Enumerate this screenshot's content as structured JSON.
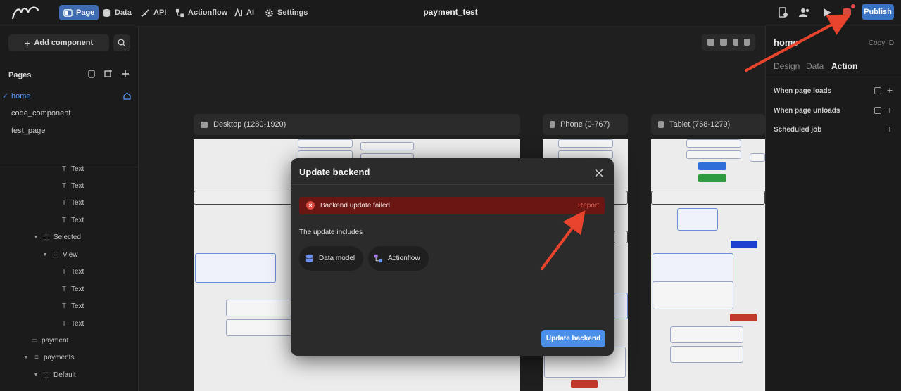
{
  "topbar": {
    "nav": [
      {
        "label": "Page",
        "icon": "page-icon",
        "active": true
      },
      {
        "label": "Data",
        "icon": "database-icon"
      },
      {
        "label": "API",
        "icon": "api-icon"
      },
      {
        "label": "Actionflow",
        "icon": "actionflow-icon"
      },
      {
        "label": "AI",
        "icon": "ai-icon"
      },
      {
        "label": "Settings",
        "icon": "gear-icon"
      }
    ],
    "title": "payment_test",
    "publish_label": "Publish"
  },
  "sidebar": {
    "add_component_label": "Add component",
    "pages_label": "Pages",
    "pages": [
      {
        "label": "home",
        "active": true
      },
      {
        "label": "code_component"
      },
      {
        "label": "test_page"
      }
    ],
    "tree": [
      {
        "label": "Text",
        "icon": "text-icon"
      },
      {
        "label": "Text",
        "icon": "text-icon"
      },
      {
        "label": "Text",
        "icon": "text-icon"
      },
      {
        "label": "Text",
        "icon": "text-icon"
      },
      {
        "label": "Selected",
        "icon": "view-icon"
      },
      {
        "label": "View",
        "icon": "view-icon"
      },
      {
        "label": "Text",
        "icon": "text-icon"
      },
      {
        "label": "Text",
        "icon": "text-icon"
      },
      {
        "label": "Text",
        "icon": "text-icon"
      },
      {
        "label": "Text",
        "icon": "text-icon"
      },
      {
        "label": "payment",
        "icon": "component-icon"
      },
      {
        "label": "payments",
        "icon": "list-icon"
      },
      {
        "label": "Default",
        "icon": "view-icon"
      }
    ]
  },
  "right_panel": {
    "title": "home",
    "copy_id_label": "Copy ID",
    "tabs": [
      {
        "label": "Design"
      },
      {
        "label": "Data"
      },
      {
        "label": "Action",
        "active": true
      }
    ],
    "rows": [
      {
        "label": "When page loads"
      },
      {
        "label": "When page unloads"
      },
      {
        "label": "Scheduled job"
      }
    ]
  },
  "canvas": {
    "frames": [
      {
        "label": "Desktop (1280-1920)"
      },
      {
        "label": "Phone (0-767)"
      },
      {
        "label": "Tablet (768-1279)"
      }
    ]
  },
  "modal": {
    "title": "Update backend",
    "error_text": "Backend update failed",
    "report_label": "Report",
    "includes_label": "The update includes",
    "items": [
      {
        "label": "Data model",
        "icon": "database-icon"
      },
      {
        "label": "Actionflow",
        "icon": "actionflow-icon"
      }
    ],
    "update_button_label": "Update backend"
  },
  "colors": {
    "accent": "#4a90e8",
    "error_bg": "#6a1713",
    "error_text": "#e0605a",
    "annotation_arrow": "#e8432c"
  }
}
